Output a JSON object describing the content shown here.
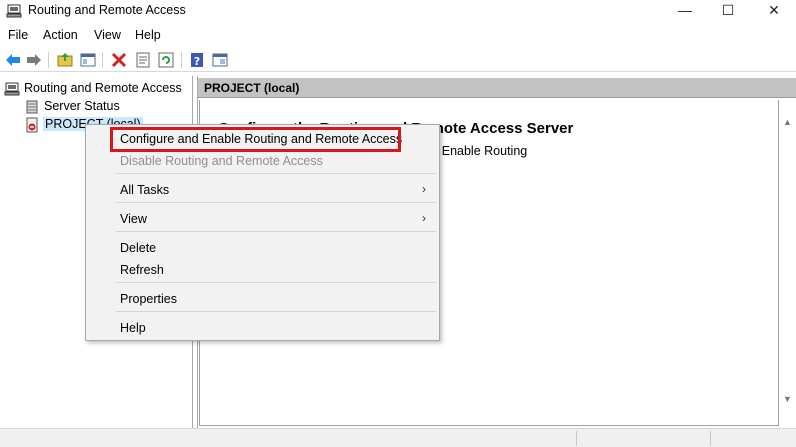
{
  "window": {
    "title": "Routing and Remote Access",
    "minimize_glyph": "—",
    "maximize_glyph": "☐",
    "close_glyph": "✕"
  },
  "menubar": {
    "items": [
      "File",
      "Action",
      "View",
      "Help"
    ]
  },
  "toolbar": {
    "buttons": [
      "back-icon",
      "forward-icon",
      "up-folder-icon",
      "show-hide-tree-icon",
      "delete-icon",
      "properties-icon",
      "refresh-icon",
      "help-icon",
      "export-list-icon"
    ]
  },
  "tree": {
    "root": "Routing and Remote Access",
    "children": [
      "Server Status",
      "PROJECT (local)"
    ]
  },
  "right_pane": {
    "header": "PROJECT (local)",
    "heading": "Configure the Routing and Remote Access Server",
    "body": "on the Action menu, click Configure and Enable Routing"
  },
  "context_menu": {
    "items": [
      {
        "label": "Configure and Enable Routing and Remote Access",
        "enabled": true,
        "highlighted": true
      },
      {
        "label": "Disable Routing and Remote Access",
        "enabled": false
      },
      {
        "label": "All Tasks",
        "submenu": true
      },
      {
        "label": "View",
        "submenu": true
      },
      {
        "label": "Delete"
      },
      {
        "label": "Refresh"
      },
      {
        "label": "Properties"
      },
      {
        "label": "Help"
      }
    ],
    "submenu_glyph": "›",
    "highlight_color": "#d9161b"
  },
  "scrollbar": {
    "up_glyph": "▲",
    "down_glyph": "▼"
  }
}
